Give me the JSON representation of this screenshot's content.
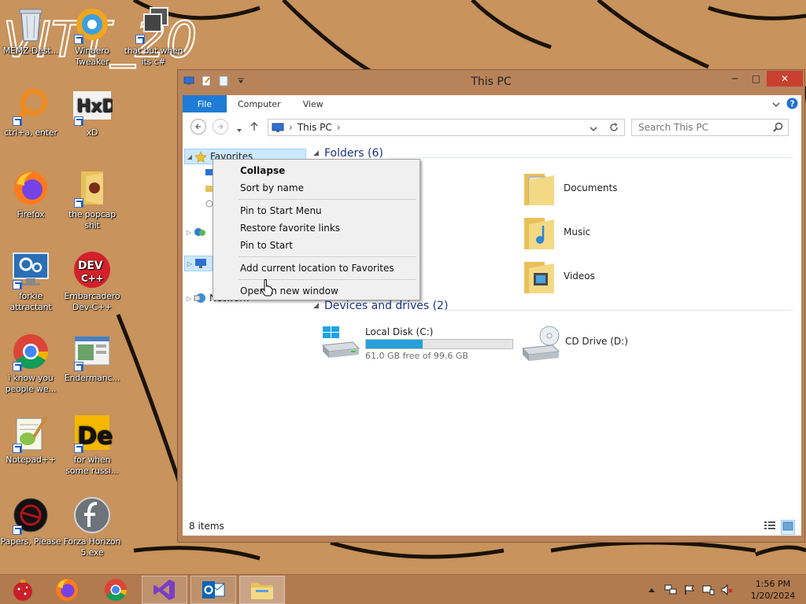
{
  "wallpaper": {
    "text": "VITT_20"
  },
  "desktop": {
    "icons": [
      {
        "label": "MEMZ-Dest...",
        "icon": "recycle-bin-icon"
      },
      {
        "label": "Winaero Tweaker",
        "icon": "winaero-tweaker-icon"
      },
      {
        "label": "that but when its c#",
        "icon": "window-stack-icon"
      },
      {
        "label": "ctrl+a, enter",
        "icon": "magnifier-icon"
      },
      {
        "label": "xD",
        "icon": "hxd-icon"
      },
      {
        "label": "Firefox",
        "icon": "firefox-icon"
      },
      {
        "label": "the popcap shit",
        "icon": "popcap-folder-icon"
      },
      {
        "label": "forkie attractant",
        "icon": "settings-monitor-icon"
      },
      {
        "label": "Embarcadero Dev-C++",
        "icon": "devcpp-icon"
      },
      {
        "label": "i know you people we...",
        "icon": "chrome-icon"
      },
      {
        "label": "Endermanc...",
        "icon": "endermanch-icon"
      },
      {
        "label": "Notepad++",
        "icon": "notepadpp-icon"
      },
      {
        "label": "for when some russi...",
        "icon": "de-icon"
      },
      {
        "label": "Papers, Please",
        "icon": "papers-please-icon"
      },
      {
        "label": "Forza Horizon 5.exe",
        "icon": "flash-icon"
      }
    ],
    "devcpp_badge": "DEV",
    "devcpp_sub": "C++",
    "hxd_text": "HxD",
    "de_text": "De"
  },
  "explorer": {
    "title": "This PC",
    "controls": {
      "minimize": "─",
      "maximize": "□",
      "close": "✕"
    },
    "tabs": [
      "File",
      "Computer",
      "View"
    ],
    "address": {
      "location": "This PC",
      "separator": "›"
    },
    "search_placeholder": "Search This PC",
    "nav_pane": {
      "favorites": "Favorites",
      "network": "Network"
    },
    "groups": {
      "folders": "Folders (6)",
      "devices": "Devices and drives (2)"
    },
    "folders": [
      "Documents",
      "Music",
      "Videos"
    ],
    "drives": [
      {
        "name": "Local Disk (C:)",
        "free": "61.0 GB free of 99.6 GB",
        "used_fraction": 0.388
      },
      {
        "name": "CD Drive (D:)"
      }
    ],
    "status": "8 items"
  },
  "context_menu": {
    "items": [
      {
        "label": "Collapse",
        "bold": true
      },
      {
        "label": "Sort by name"
      },
      {
        "label": "Pin to Start Menu"
      },
      {
        "label": "Restore favorite links"
      },
      {
        "label": "Pin to Start"
      },
      {
        "label": "Add current location to Favorites"
      },
      {
        "label": "Open in new window"
      }
    ]
  },
  "taskbar": {
    "apps": [
      "christmas-ornament-icon",
      "firefox-icon",
      "chrome-icon",
      "visual-studio-icon",
      "outlook-icon",
      "file-explorer-icon"
    ]
  },
  "clock": {
    "time": "1:56 PM",
    "date": "1/20/2024"
  },
  "colors": {
    "wallpaper": "#c8935c",
    "window_frame": "#b9835a",
    "accent": "#1e7bd6",
    "drive_fill": "#26a0da",
    "close": "#c8402f"
  }
}
